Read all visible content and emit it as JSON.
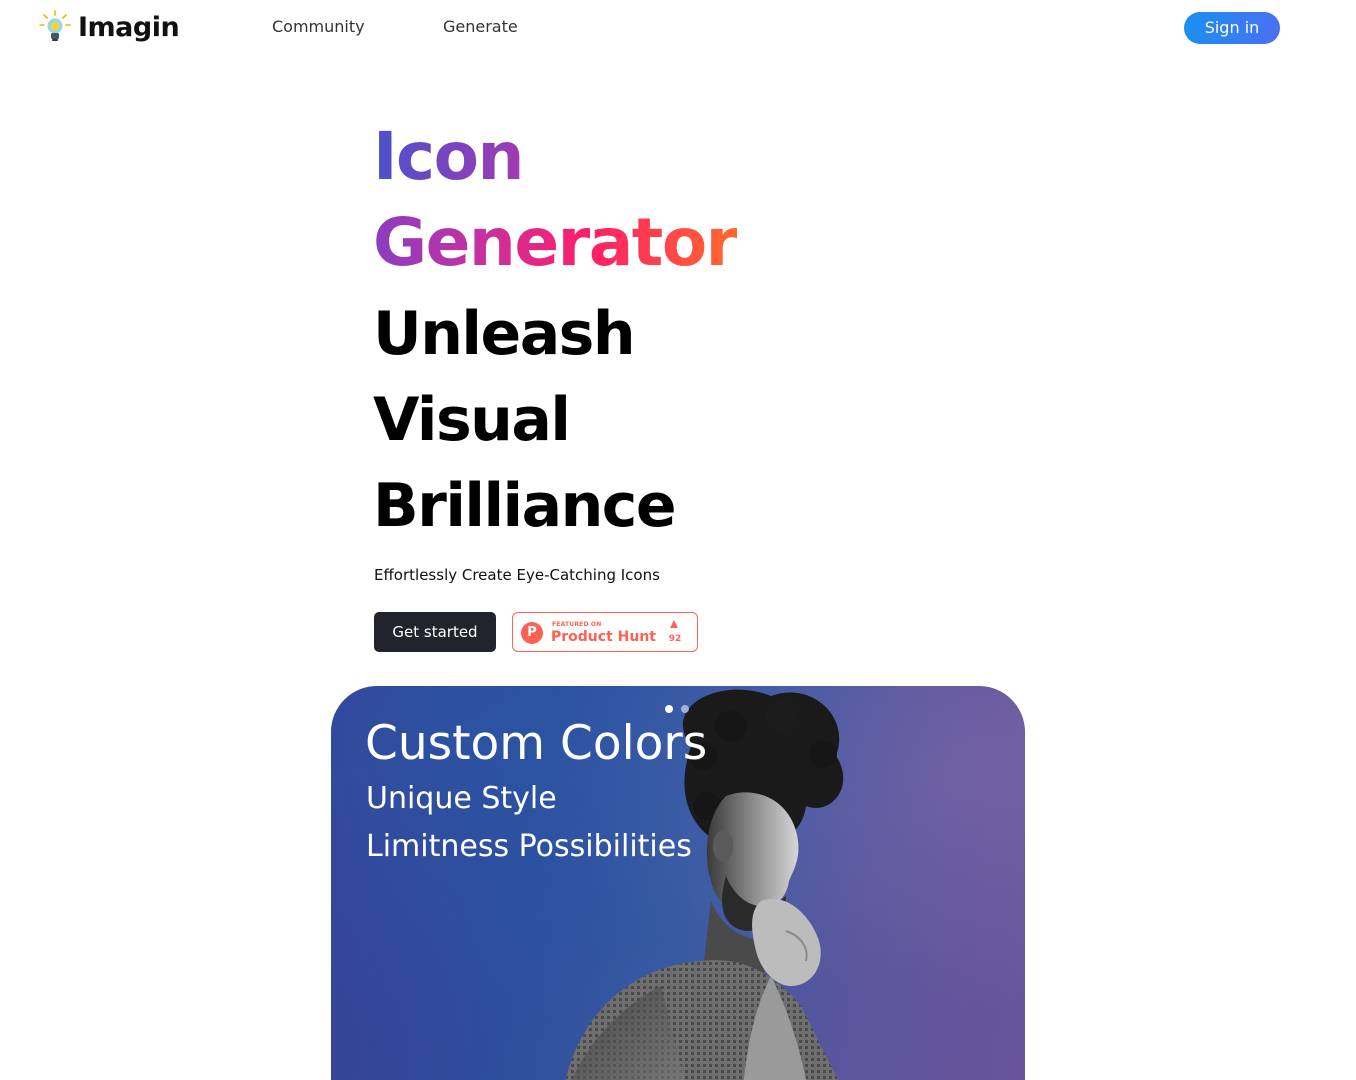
{
  "header": {
    "brand_name": "Imagin",
    "nav": [
      {
        "label": "Community"
      },
      {
        "label": "Generate"
      }
    ],
    "signin_label": "Sign in"
  },
  "hero": {
    "title_line1": "Icon",
    "title_line2": "Generator",
    "headline": [
      "Unleash",
      "Visual",
      "Brilliance"
    ],
    "subtitle": "Effortlessly Create Eye-Catching Icons",
    "cta_label": "Get started",
    "product_hunt": {
      "featured_label": "FEATURED ON",
      "name": "Product Hunt",
      "upvotes": "92"
    }
  },
  "showcase": {
    "title": "Custom Colors",
    "line1": "Unique Style",
    "line2": "Limitness Possibilities",
    "slides_total": 2,
    "active_slide": 1
  },
  "colors": {
    "signin_gradient": [
      "#1a8ff0",
      "#4a70f2"
    ],
    "title_gradient": [
      "#4b52c8",
      "#9a3ab7",
      "#e3238b",
      "#ff6a2c"
    ],
    "cta_background": "#23232e",
    "product_hunt_accent": "#ff6154"
  }
}
